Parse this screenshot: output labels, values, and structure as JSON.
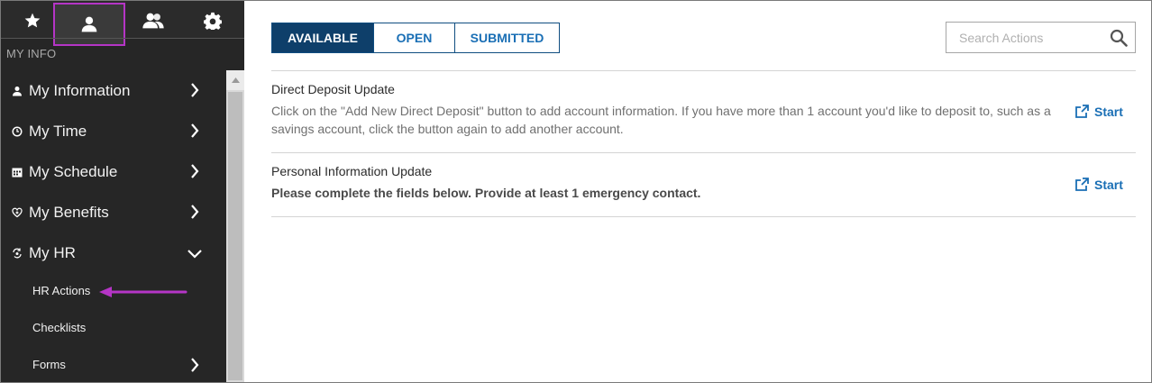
{
  "sidebar": {
    "top_icons": [
      {
        "icon": "star-icon",
        "label": "Favorites"
      },
      {
        "icon": "person-icon",
        "label": "My Info"
      },
      {
        "icon": "people-icon",
        "label": "Team"
      },
      {
        "icon": "gear-icon",
        "label": "Settings"
      }
    ],
    "section_label": "MY INFO",
    "menu": [
      {
        "label": "My Information",
        "icon": "person-icon",
        "chevron": "right"
      },
      {
        "label": "My Time",
        "icon": "clock-icon",
        "chevron": "right"
      },
      {
        "label": "My Schedule",
        "icon": "calendar-icon",
        "chevron": "right"
      },
      {
        "label": "My Benefits",
        "icon": "heart-icon",
        "chevron": "right"
      },
      {
        "label": "My HR",
        "icon": "hr-icon",
        "chevron": "down"
      }
    ],
    "submenu": [
      {
        "label": "HR Actions"
      },
      {
        "label": "Checklists"
      },
      {
        "label": "Forms",
        "chevron": "right"
      }
    ],
    "highlight_color": "#b535c6"
  },
  "main": {
    "tabs": [
      {
        "label": "AVAILABLE",
        "active": true
      },
      {
        "label": "OPEN",
        "active": false
      },
      {
        "label": "SUBMITTED",
        "active": false
      }
    ],
    "search": {
      "placeholder": "Search Actions",
      "value": ""
    },
    "actions": [
      {
        "title": "Direct Deposit Update",
        "description": "Click on the \"Add New Direct Deposit\" button to add account information. If you have more than 1 account you'd like to deposit to, such as a savings account, click the button again to add another account.",
        "start_label": "Start"
      },
      {
        "title": "Personal Information Update",
        "description": "Please complete the fields below. Provide at least 1 emergency contact.",
        "start_label": "Start"
      }
    ]
  },
  "colors": {
    "sidebar_bg": "#262626",
    "active_tab_bg": "#0e3f6a",
    "link_blue": "#1a6fb5",
    "annotation_magenta": "#b535c6"
  }
}
